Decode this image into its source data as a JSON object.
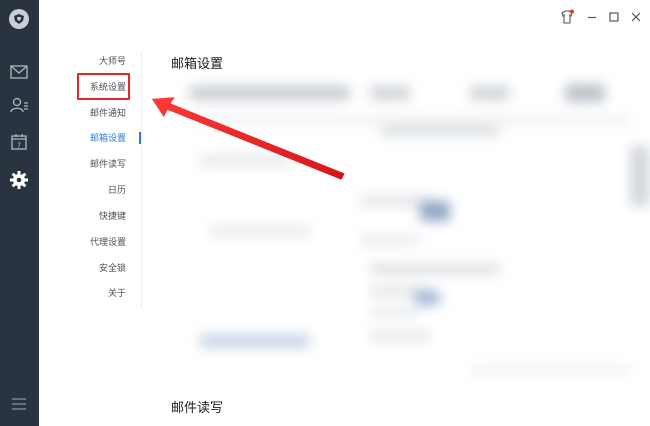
{
  "nav": {
    "items": [
      {
        "label": "大师号",
        "active": false
      },
      {
        "label": "系统设置",
        "active": false
      },
      {
        "label": "邮件通知",
        "active": false
      },
      {
        "label": "邮箱设置",
        "active": true
      },
      {
        "label": "邮件读写",
        "active": false
      },
      {
        "label": "日历",
        "active": false
      },
      {
        "label": "快捷键",
        "active": false
      },
      {
        "label": "代理设置",
        "active": false
      },
      {
        "label": "安全锁",
        "active": false
      },
      {
        "label": "关于",
        "active": false
      }
    ]
  },
  "main": {
    "section_title": "邮箱设置",
    "next_section_title": "邮件读写"
  },
  "rail": {
    "icons": [
      "app-logo-icon",
      "mail-icon",
      "contacts-icon",
      "calendar-icon",
      "settings-icon",
      "menu-icon"
    ]
  },
  "titlebar": {
    "icons": [
      "skin-icon",
      "minimize-icon",
      "maximize-icon",
      "close-icon"
    ]
  },
  "colors": {
    "rail": "#2a3340",
    "accent": "#2b7cd6",
    "annotation": "#e0282c"
  }
}
